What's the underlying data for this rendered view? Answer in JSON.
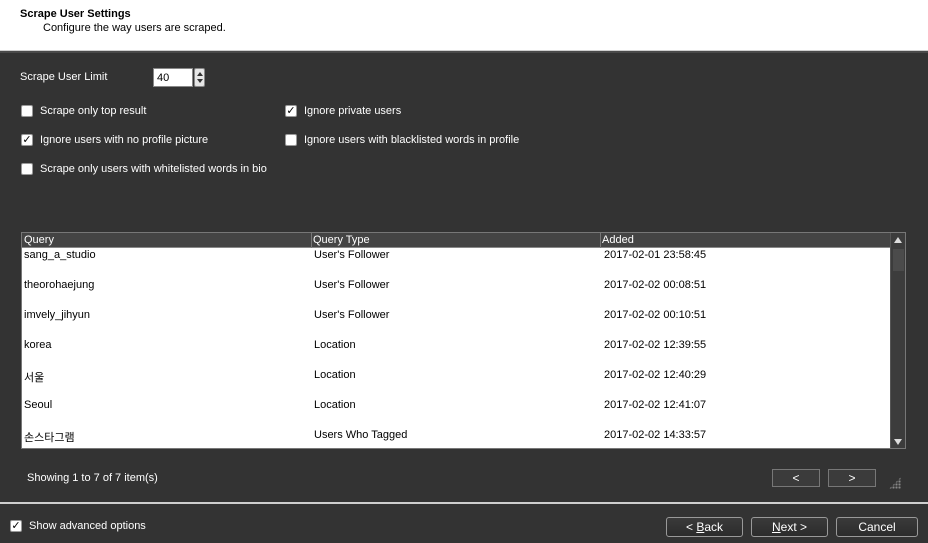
{
  "header": {
    "title": "Scrape User Settings",
    "subtitle": "Configure the way users are scraped."
  },
  "limit": {
    "label": "Scrape User Limit",
    "value": "40"
  },
  "options": [
    {
      "label": "Scrape only top result",
      "checked": false
    },
    {
      "label": "Ignore private users",
      "checked": true
    },
    {
      "label": "Ignore users with no profile picture",
      "checked": true
    },
    {
      "label": "Ignore users with blacklisted words in profile",
      "checked": false
    },
    {
      "label": "Scrape only users with whitelisted words in bio",
      "checked": false
    }
  ],
  "grid": {
    "columns": [
      "Query",
      "Query Type",
      "Added"
    ],
    "rows": [
      {
        "query": "sang_a_studio",
        "type": "User's Follower",
        "added": "2017-02-01 23:58:45"
      },
      {
        "query": "theorohaejung",
        "type": "User's Follower",
        "added": "2017-02-02 00:08:51"
      },
      {
        "query": "imvely_jihyun",
        "type": "User's Follower",
        "added": "2017-02-02 00:10:51"
      },
      {
        "query": "korea",
        "type": "Location",
        "added": "2017-02-02 12:39:55"
      },
      {
        "query": "서울",
        "type": "Location",
        "added": "2017-02-02 12:40:29"
      },
      {
        "query": "Seoul",
        "type": "Location",
        "added": "2017-02-02 12:41:07"
      },
      {
        "query": "손스타그램",
        "type": "Users Who Tagged",
        "added": "2017-02-02 14:33:57"
      }
    ]
  },
  "pager": {
    "status": "Showing 1 to 7 of 7 item(s)",
    "prev": "<",
    "next": ">"
  },
  "footer": {
    "advanced_label": "Show advanced options",
    "advanced_checked": true,
    "back_prefix": "< ",
    "back_key": "B",
    "back_rest": "ack",
    "next_key": "N",
    "next_rest": "ext >",
    "cancel": "Cancel"
  },
  "check_glyph": "✓"
}
